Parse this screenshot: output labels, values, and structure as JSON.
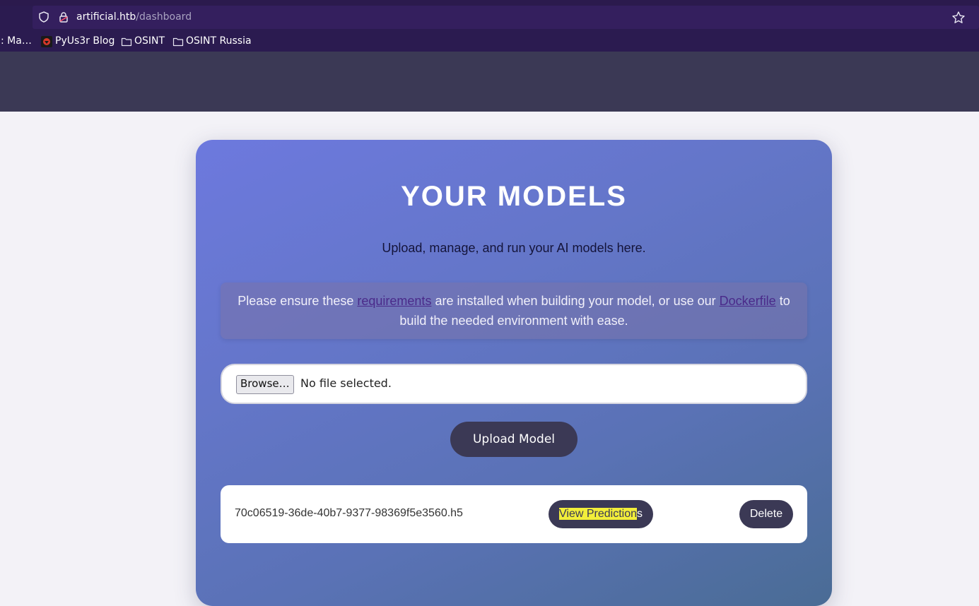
{
  "browser": {
    "url_host": "artificial.htb",
    "url_path": "/dashboard",
    "icons": [
      "shield-icon",
      "lock-icon",
      "star-icon"
    ]
  },
  "bookmarks": [
    {
      "label": ": Ma…"
    },
    {
      "label": "PyUs3r Blog",
      "icon": "pyus3r-favicon"
    },
    {
      "label": "OSINT",
      "icon": "folder-icon"
    },
    {
      "label": "OSINT Russia",
      "icon": "folder-icon"
    }
  ],
  "page": {
    "title": "YOUR MODELS",
    "subtitle": "Upload, manage, and run your AI models here.",
    "notice": {
      "part1": "Please ensure these ",
      "link1": "requirements",
      "part2": " are installed when building your model, or use our ",
      "link2": "Dockerfile",
      "part3": " to build the needed environment with ease."
    },
    "file_input": {
      "browse_label": "Browse…",
      "status": "No file selected."
    },
    "upload_label": "Upload Model",
    "models": [
      {
        "filename": "70c06519-36de-40b7-9377-98369f5e3560.h5",
        "view_label_highlighted": "View Prediction",
        "view_label_rest": "s",
        "delete_label": "Delete"
      }
    ]
  },
  "colors": {
    "browser_bg": "#2b1b50",
    "nav_bg": "#3b3955",
    "card_gradient_start": "#6d79de",
    "card_gradient_end": "#4a6c95",
    "button_bg": "#3b3955",
    "highlight": "#f2ee3a"
  }
}
